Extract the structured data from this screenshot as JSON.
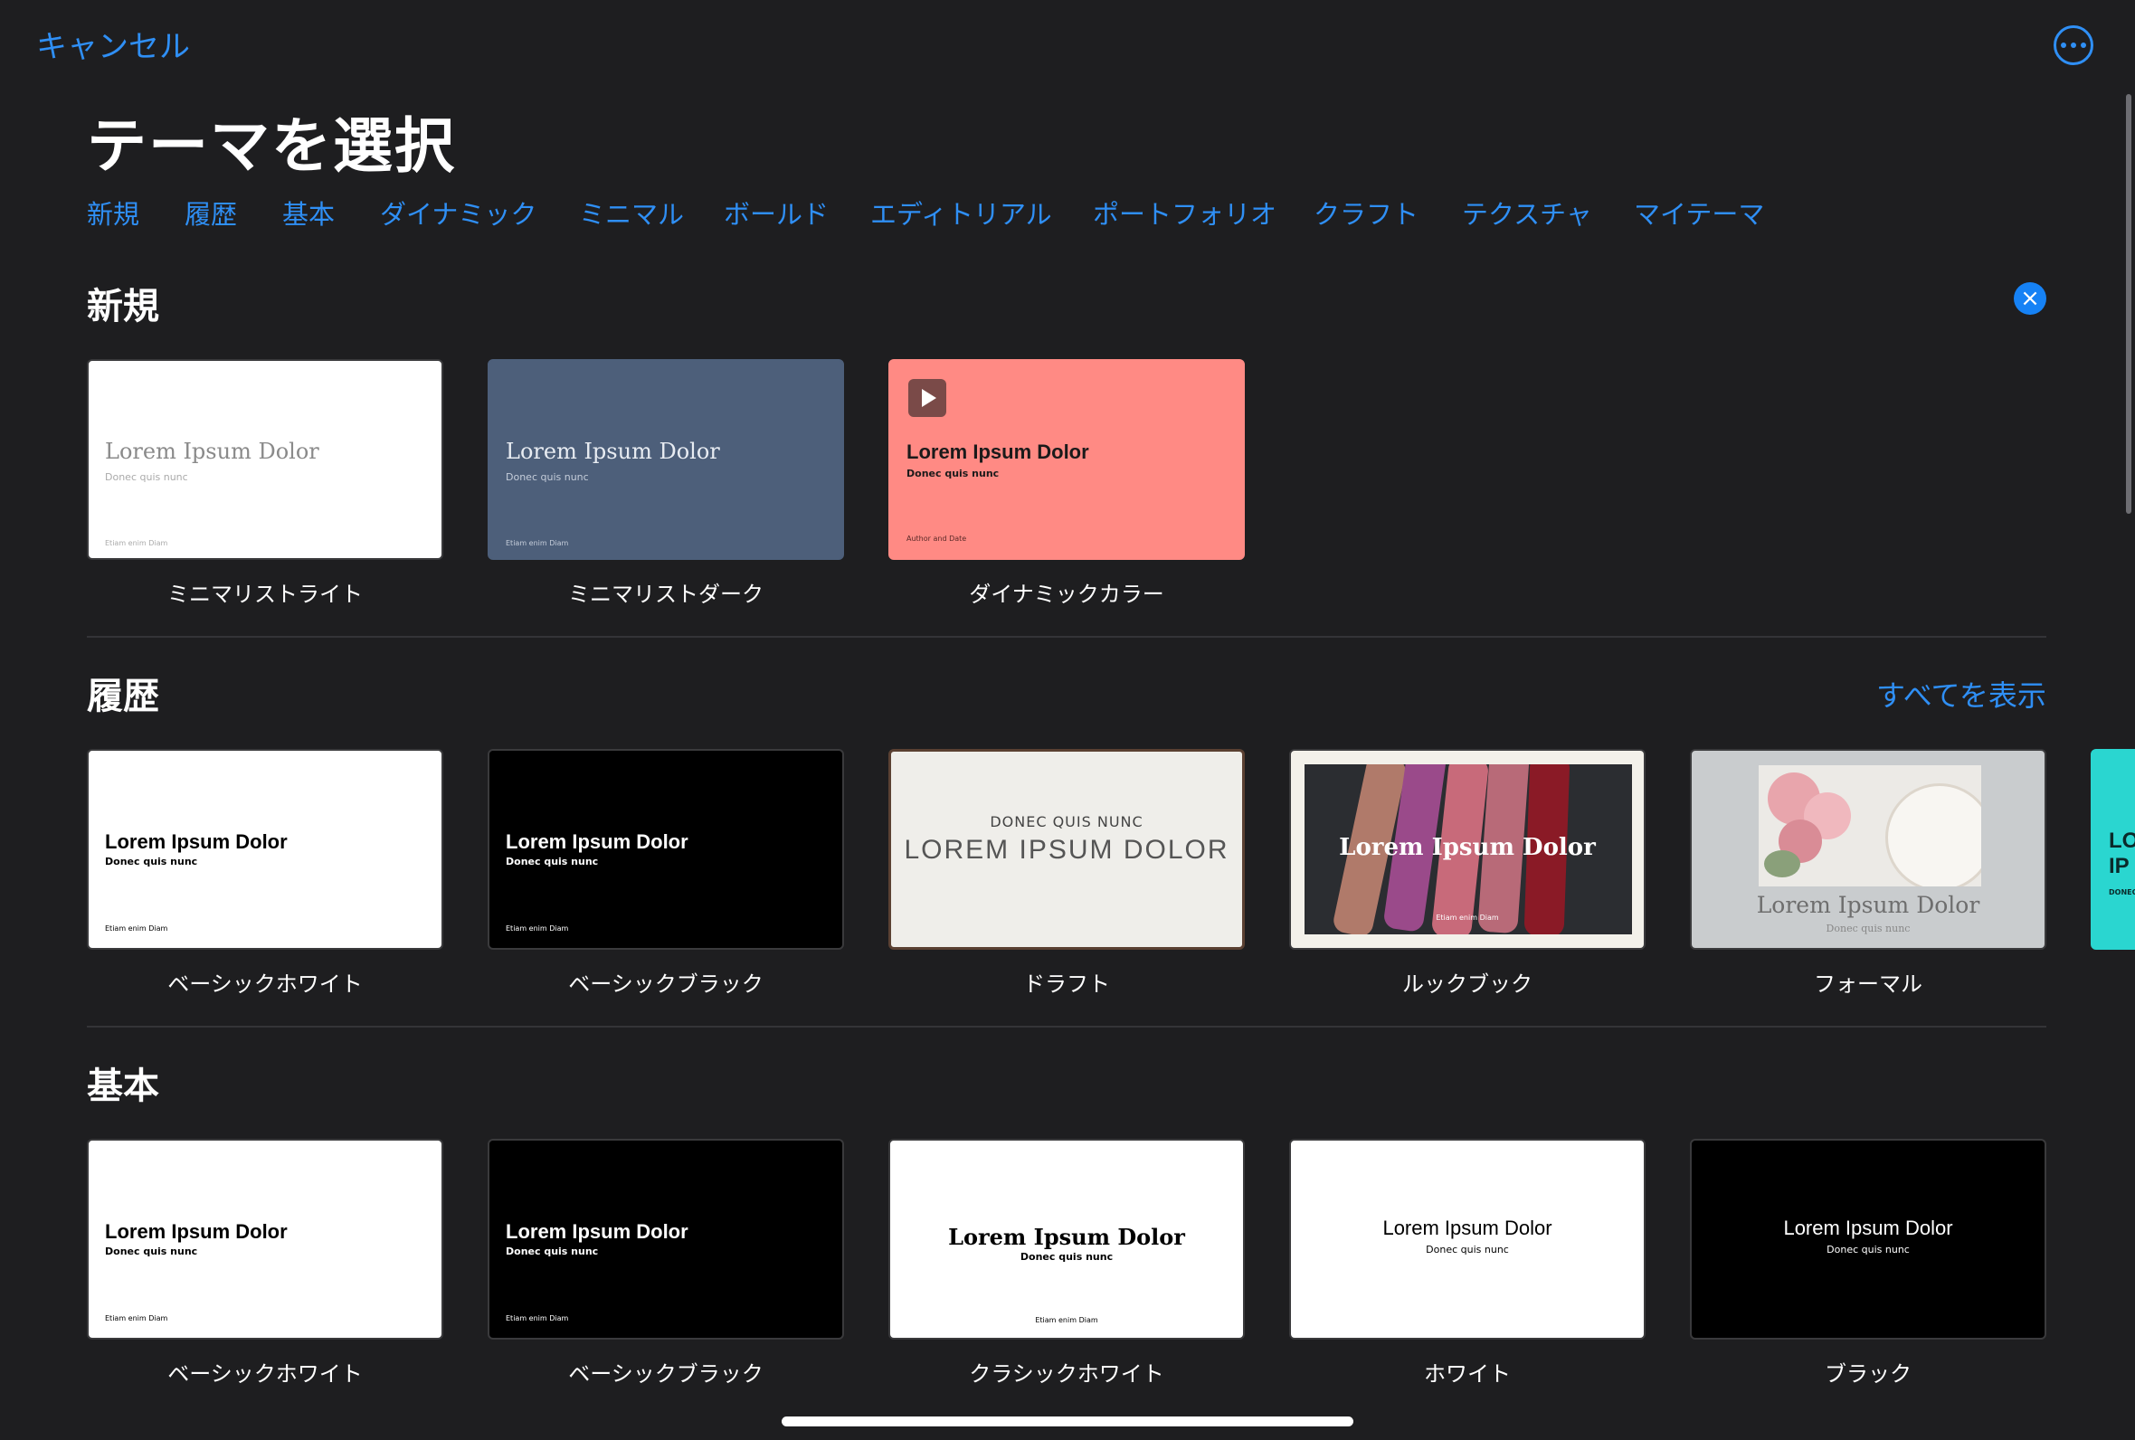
{
  "header": {
    "cancel_label": "キャンセル",
    "more_icon": "ellipsis-circle-icon",
    "title": "テーマを選択"
  },
  "tabs": [
    "新規",
    "履歴",
    "基本",
    "ダイナミック",
    "ミニマル",
    "ボールド",
    "エディトリアル",
    "ポートフォリオ",
    "クラフト",
    "テクスチャ",
    "マイテーマ"
  ],
  "sections": {
    "new": {
      "title": "新規",
      "close_icon": "xmark-circle-icon",
      "themes": [
        {
          "name": "ミニマリストライト",
          "thumb_title": "Lorem Ipsum Dolor",
          "thumb_sub": "Donec quis nunc",
          "thumb_foot": "Etiam enim Diam"
        },
        {
          "name": "ミニマリストダーク",
          "thumb_title": "Lorem Ipsum Dolor",
          "thumb_sub": "Donec quis nunc",
          "thumb_foot": "Etiam enim Diam"
        },
        {
          "name": "ダイナミックカラー",
          "thumb_title": "Lorem Ipsum Dolor",
          "thumb_sub": "Donec quis nunc",
          "thumb_foot": "Author and Date",
          "play_icon": "play-icon"
        }
      ]
    },
    "recent": {
      "title": "履歴",
      "show_all_label": "すべてを表示",
      "themes": [
        {
          "name": "ベーシックホワイト",
          "thumb_title": "Lorem Ipsum Dolor",
          "thumb_sub": "Donec quis nunc",
          "thumb_foot": "Etiam enim Diam"
        },
        {
          "name": "ベーシックブラック",
          "thumb_title": "Lorem Ipsum Dolor",
          "thumb_sub": "Donec quis nunc",
          "thumb_foot": "Etiam enim Diam"
        },
        {
          "name": "ドラフト",
          "thumb_title": "LOREM IPSUM DOLOR",
          "thumb_sub": "DONEC QUIS NUNC"
        },
        {
          "name": "ルックブック",
          "thumb_title": "Lorem Ipsum Dolor",
          "thumb_foot": "Etiam enim Diam"
        },
        {
          "name": "フォーマル",
          "thumb_title": "Lorem Ipsum Dolor",
          "thumb_sub": "Donec quis nunc"
        },
        {
          "thumb_title": "LO IP",
          "thumb_sub": "DONEC"
        }
      ]
    },
    "basic": {
      "title": "基本",
      "themes": [
        {
          "name": "ベーシックホワイト",
          "thumb_title": "Lorem Ipsum Dolor",
          "thumb_sub": "Donec quis nunc",
          "thumb_foot": "Etiam enim Diam"
        },
        {
          "name": "ベーシックブラック",
          "thumb_title": "Lorem Ipsum Dolor",
          "thumb_sub": "Donec quis nunc",
          "thumb_foot": "Etiam enim Diam"
        },
        {
          "name": "クラシックホワイト",
          "thumb_title": "Lorem Ipsum Dolor",
          "thumb_sub": "Donec quis nunc",
          "thumb_foot": "Etiam enim Diam"
        },
        {
          "name": "ホワイト",
          "thumb_title": "Lorem Ipsum Dolor",
          "thumb_sub": "Donec quis nunc"
        },
        {
          "name": "ブラック",
          "thumb_title": "Lorem Ipsum Dolor",
          "thumb_sub": "Donec quis nunc"
        }
      ]
    }
  },
  "colors": {
    "accent": "#2f8ff5",
    "background": "#1e1e20",
    "minimalist_dark": "#4d5f7a",
    "dynamic_color": "#ff8a84"
  }
}
